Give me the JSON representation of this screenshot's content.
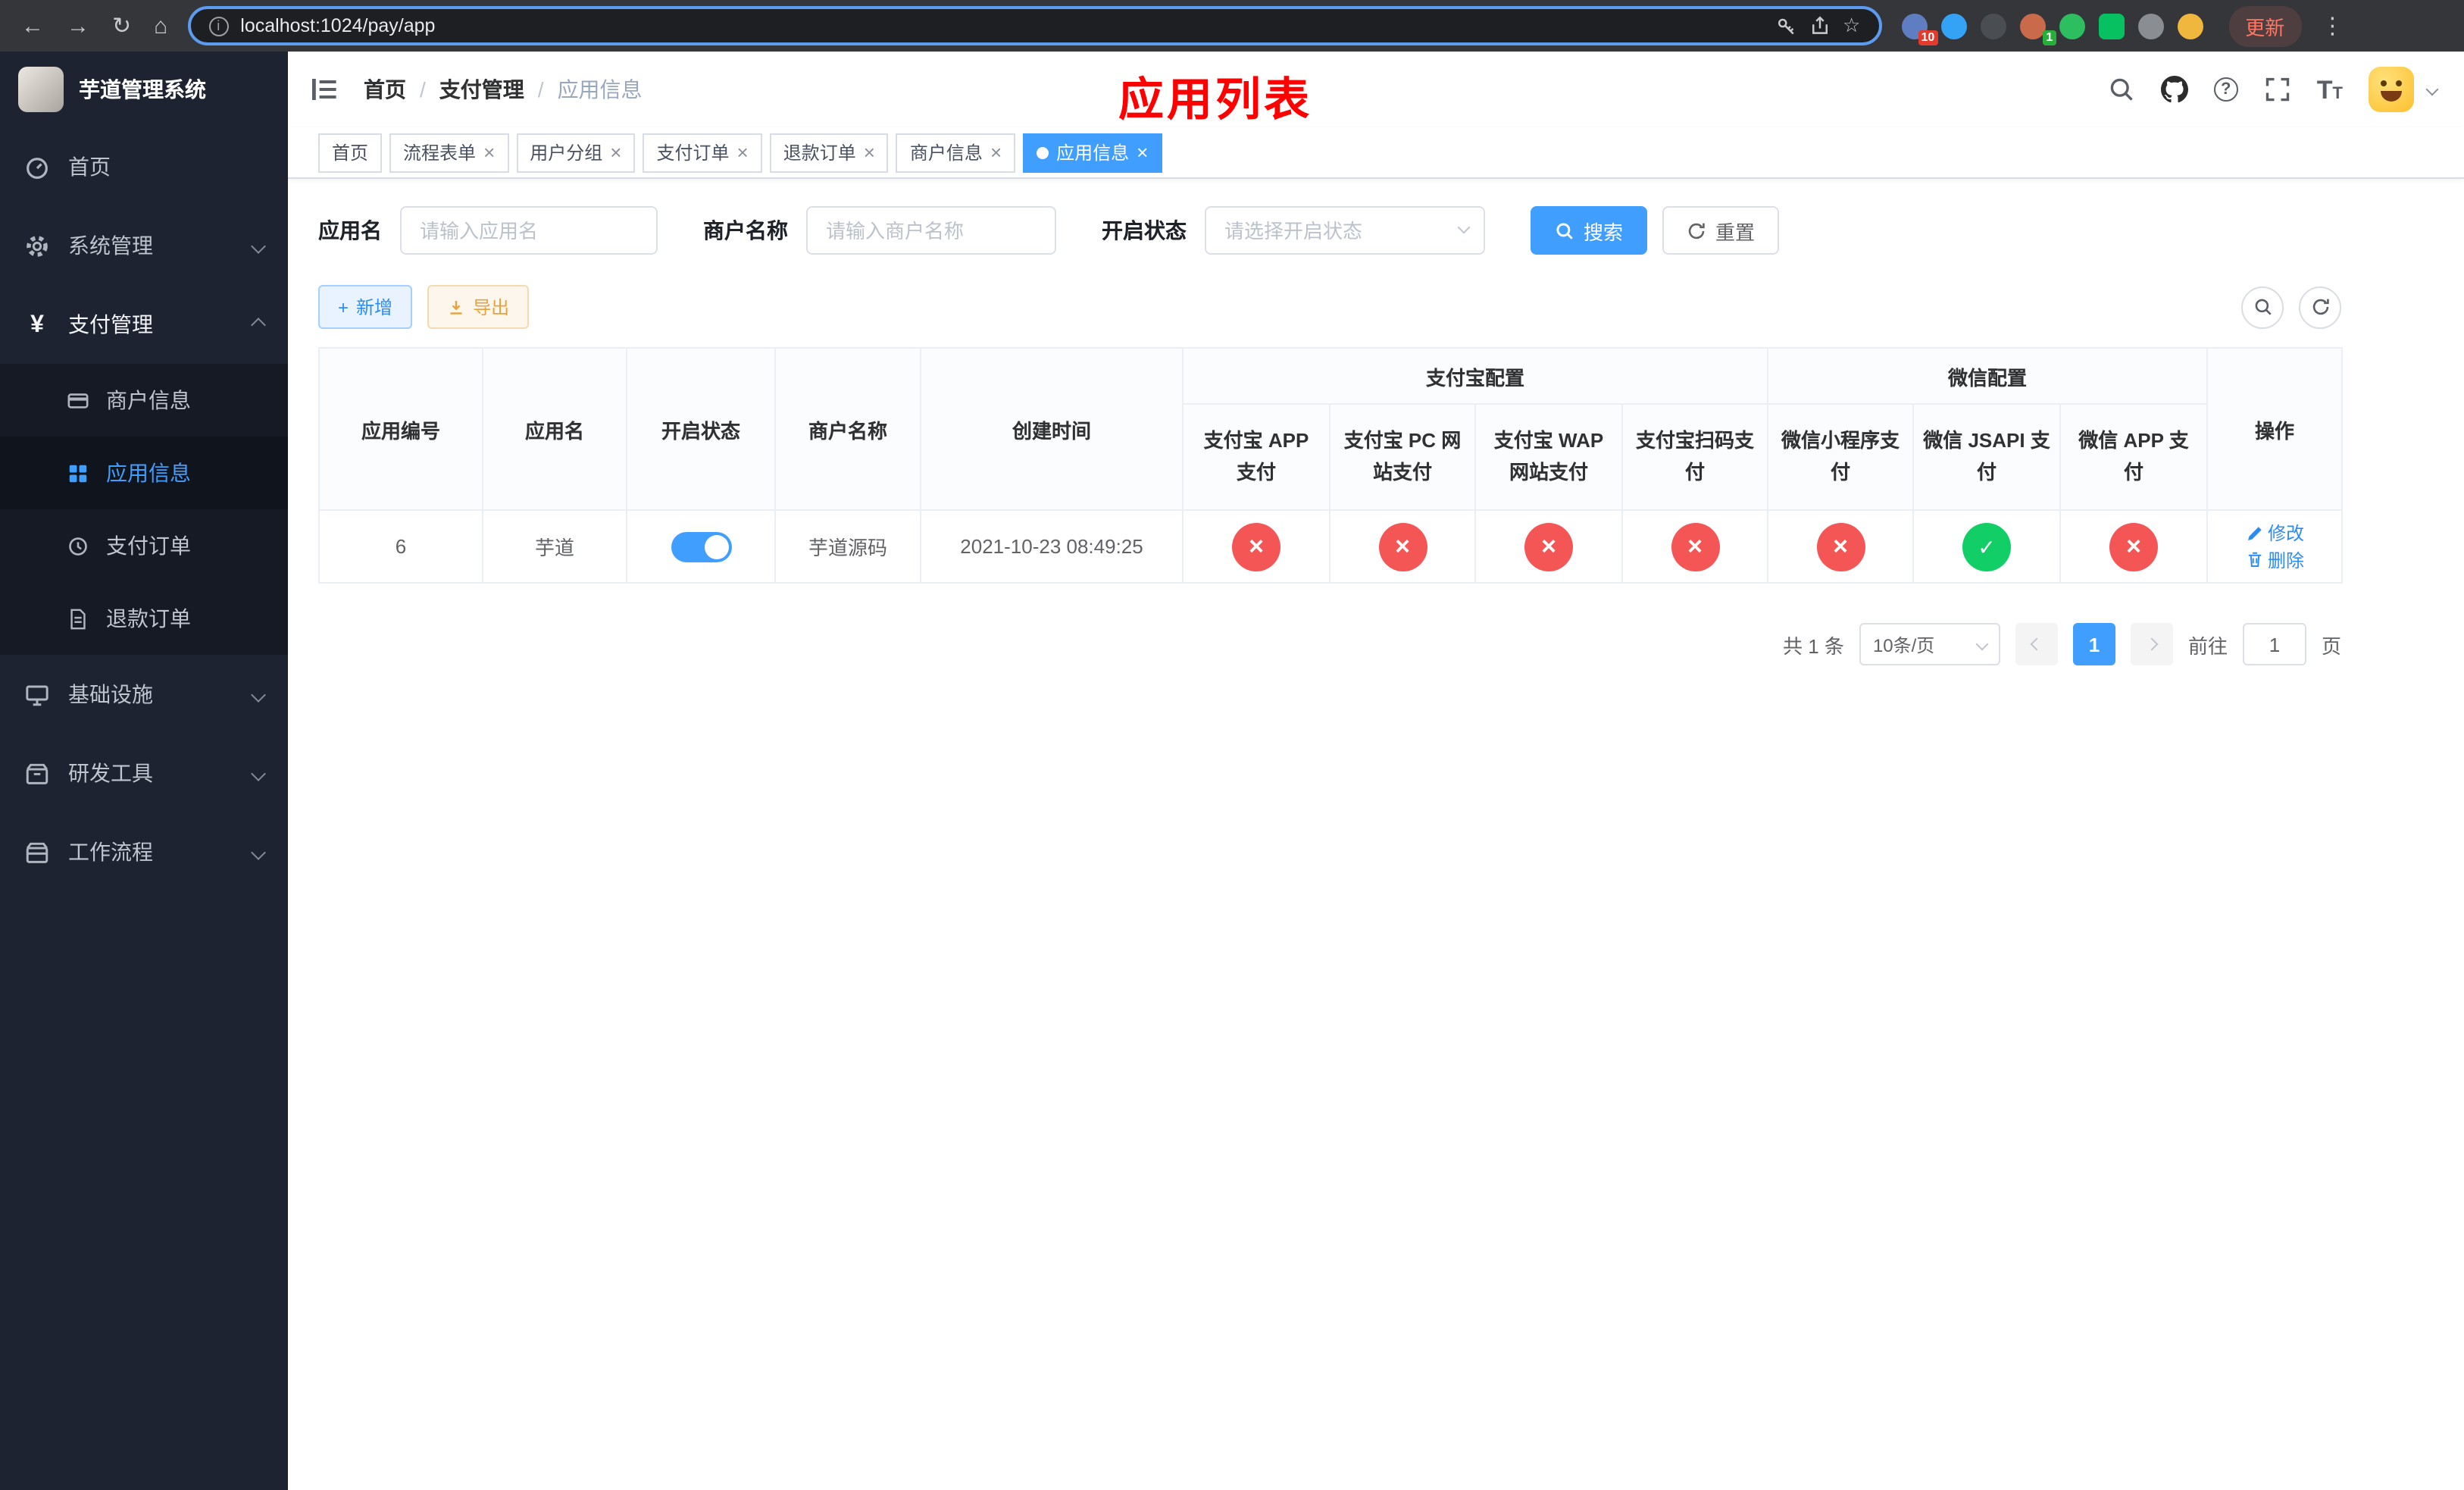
{
  "icons": {
    "close": "×",
    "plus": "+",
    "yen": "¥"
  },
  "browser": {
    "back_icon": "←",
    "forward_icon": "→",
    "reload_icon": "↻",
    "home_icon": "⌂",
    "info_icon": "i",
    "url": "localhost:1024/pay/app",
    "star_icon": "☆",
    "extension_badge_1": "10",
    "extension_badge_2": "1",
    "update_label": "更新",
    "menu_icon": "⋮"
  },
  "sidebar": {
    "logo_title": "芋道管理系统",
    "items": [
      {
        "label": "首页"
      },
      {
        "label": "系统管理"
      },
      {
        "label": "支付管理"
      },
      {
        "label": "基础设施"
      },
      {
        "label": "研发工具"
      },
      {
        "label": "工作流程"
      }
    ],
    "submenu": [
      {
        "label": "商户信息"
      },
      {
        "label": "应用信息"
      },
      {
        "label": "支付订单"
      },
      {
        "label": "退款订单"
      }
    ]
  },
  "header": {
    "breadcrumb": [
      "首页",
      "支付管理",
      "应用信息"
    ],
    "separator": "/",
    "page_title": "应用列表",
    "help_icon": "?",
    "font_icon_large": "T",
    "font_icon_small": "T"
  },
  "tabs": [
    {
      "label": "首页"
    },
    {
      "label": "流程表单"
    },
    {
      "label": "用户分组"
    },
    {
      "label": "支付订单"
    },
    {
      "label": "退款订单"
    },
    {
      "label": "商户信息"
    },
    {
      "label": "应用信息"
    }
  ],
  "filters": {
    "app_name_label": "应用名",
    "app_name_placeholder": "请输入应用名",
    "merchant_label": "商户名称",
    "merchant_placeholder": "请输入商户名称",
    "status_label": "开启状态",
    "status_placeholder": "请选择开启状态",
    "search_label": "搜索",
    "reset_label": "重置"
  },
  "toolbar": {
    "add_label": "新增",
    "export_label": "导出"
  },
  "table": {
    "columns": {
      "app_id": "应用编号",
      "app_name": "应用名",
      "status": "开启状态",
      "merchant": "商户名称",
      "created": "创建时间",
      "alipay_group": "支付宝配置",
      "alipay_app": "支付宝 APP 支付",
      "alipay_pc": "支付宝 PC 网站支付",
      "alipay_wap": "支付宝 WAP 网站支付",
      "alipay_qr": "支付宝扫码支付",
      "wechat_group": "微信配置",
      "wechat_mini": "微信小程序支付",
      "wechat_jsapi": "微信 JSAPI 支付",
      "wechat_app": "微信 APP 支付",
      "actions": "操作"
    },
    "rows": [
      {
        "app_id": "6",
        "app_name": "芋道",
        "enabled": "true",
        "merchant": "芋道源码",
        "created": "2021-10-23 08:49:25",
        "statuses": [
          "cross",
          "cross",
          "cross",
          "cross",
          "cross",
          "check",
          "cross"
        ],
        "edit_label": "修改",
        "delete_label": "删除"
      }
    ]
  },
  "pagination": {
    "total_text": "共 1 条",
    "page_size": "10条/页",
    "current_page": "1",
    "goto_label": "前往",
    "goto_value": "1",
    "page_unit": "页"
  }
}
